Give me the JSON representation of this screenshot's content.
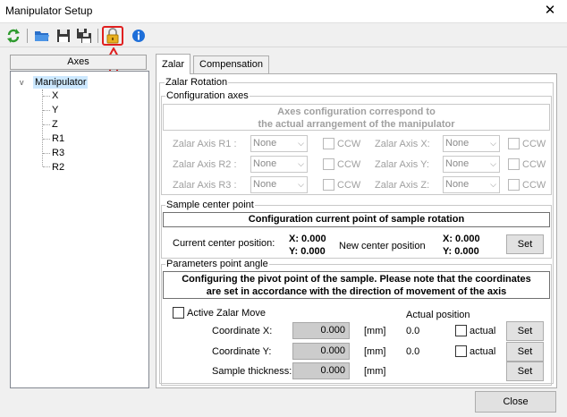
{
  "window": {
    "title": "Manipulator Setup",
    "close_glyph": "✕"
  },
  "toolbar": {
    "icons": [
      "refresh-icon",
      "open-folder-icon",
      "save-icon",
      "save-as-icon",
      "lock-icon",
      "info-icon"
    ]
  },
  "axes": {
    "header": "Axes",
    "root": "Manipulator",
    "children": [
      "X",
      "Y",
      "Z",
      "R1",
      "R3",
      "R2"
    ],
    "expander_glyph": "v"
  },
  "tabs": [
    {
      "label": "Zalar",
      "active": true
    },
    {
      "label": "Compensation",
      "active": false
    }
  ],
  "zalar_rotation": {
    "label": "Zalar Rotation",
    "configuration_axes": {
      "label": "Configuration axes",
      "heading_line1": "Axes configuration correspond to",
      "heading_line2": "the actual arrangement of the manipulator",
      "rows": [
        {
          "left_label": "Zalar Axis R1 :",
          "left_value": "None",
          "right_label": "Zalar Axis X:",
          "right_value": "None"
        },
        {
          "left_label": "Zalar Axis R2 :",
          "left_value": "None",
          "right_label": "Zalar Axis Y:",
          "right_value": "None"
        },
        {
          "left_label": "Zalar Axis R3 :",
          "left_value": "None",
          "right_label": "Zalar Axis Z:",
          "right_value": "None"
        }
      ],
      "ccw_label": "CCW"
    },
    "sample_center": {
      "label": "Sample center point",
      "heading": "Configuration current point of sample rotation",
      "current_label": "Current center position:",
      "current_x": "X: 0.000",
      "current_y": "Y: 0.000",
      "new_label": "New center position",
      "new_x": "X: 0.000",
      "new_y": "Y: 0.000",
      "set_label": "Set"
    },
    "parameters": {
      "label": "Parameters point angle",
      "heading_line1": "Configuring the pivot point of the sample. Please note that the coordinates",
      "heading_line2": "are set in accordance with the direction of movement of the axis",
      "active_label": "Active Zalar Move",
      "actual_position_label": "Actual position",
      "rows": [
        {
          "label": "Coordinate X:",
          "value": "0.000",
          "unit": "[mm]",
          "actual": "0.0",
          "actual_chk": "actual",
          "set": "Set"
        },
        {
          "label": "Coordinate Y:",
          "value": "0.000",
          "unit": "[mm]",
          "actual": "0.0",
          "actual_chk": "actual",
          "set": "Set"
        },
        {
          "label": "Sample thickness:",
          "value": "0.000",
          "unit": "[mm]",
          "set": "Set"
        }
      ]
    }
  },
  "footer": {
    "close_label": "Close"
  },
  "colors": {
    "annotation_red": "#e02020",
    "selection": "#cce8ff",
    "info_blue": "#1e6fd9"
  }
}
